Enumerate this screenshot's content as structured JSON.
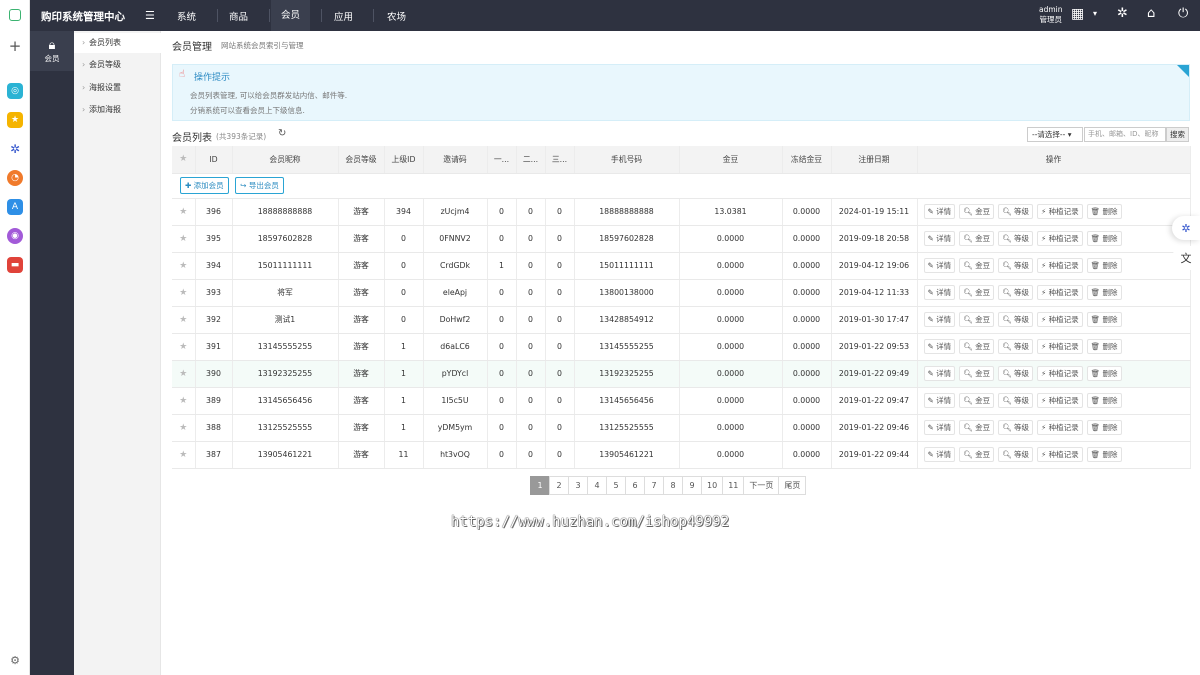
{
  "app": {
    "title": "购印系统管理中心"
  },
  "topnav": [
    "系统",
    "商品",
    "会员",
    "应用",
    "农场"
  ],
  "topnav_active": "会员",
  "user": {
    "name": "admin",
    "role": "管理员"
  },
  "side1": {
    "active_label": "会员"
  },
  "side2": [
    "会员列表",
    "会员等级",
    "海报设置",
    "添加海报"
  ],
  "side2_active": "会员列表",
  "breadcrumb": {
    "title": "会员管理",
    "sub": "网站系统会员索引与管理"
  },
  "tips": {
    "title": "操作提示",
    "lines": [
      "会员列表管理, 可以给会员群发站内信、邮件等.",
      "分销系统可以查看会员上下级信息."
    ]
  },
  "list": {
    "title": "会员列表",
    "count": "(共393条记录)"
  },
  "search": {
    "select": "--请选择--",
    "placeholder": "手机、邮箱、ID、昵称",
    "button": "搜索"
  },
  "table": {
    "headers": [
      "",
      "ID",
      "会员昵称",
      "会员等级",
      "上级ID",
      "邀请码",
      "一...",
      "二...",
      "三...",
      "手机号码",
      "金豆",
      "冻结金豆",
      "注册日期",
      "操作"
    ],
    "toolbar": {
      "add": "添加会员",
      "export": "导出会员"
    },
    "actions": [
      "详情",
      "金豆",
      "等级",
      "种植记录",
      "删除"
    ],
    "rows": [
      {
        "id": "396",
        "nick": "18888888888",
        "level": "游客",
        "pid": "394",
        "code": "zUcjm4",
        "l1": "0",
        "l2": "0",
        "l3": "0",
        "phone": "18888888888",
        "beans": "13.0381",
        "frozen": "0.0000",
        "date": "2024-01-19 15:11"
      },
      {
        "id": "395",
        "nick": "18597602828",
        "level": "游客",
        "pid": "0",
        "code": "0FNNV2",
        "l1": "0",
        "l2": "0",
        "l3": "0",
        "phone": "18597602828",
        "beans": "0.0000",
        "frozen": "0.0000",
        "date": "2019-09-18 20:58"
      },
      {
        "id": "394",
        "nick": "15011111111",
        "level": "游客",
        "pid": "0",
        "code": "CrdGDk",
        "l1": "1",
        "l2": "0",
        "l3": "0",
        "phone": "15011111111",
        "beans": "0.0000",
        "frozen": "0.0000",
        "date": "2019-04-12 19:06"
      },
      {
        "id": "393",
        "nick": "将军",
        "level": "游客",
        "pid": "0",
        "code": "eleApj",
        "l1": "0",
        "l2": "0",
        "l3": "0",
        "phone": "13800138000",
        "beans": "0.0000",
        "frozen": "0.0000",
        "date": "2019-04-12 11:33"
      },
      {
        "id": "392",
        "nick": "测试1",
        "level": "游客",
        "pid": "0",
        "code": "DoHwf2",
        "l1": "0",
        "l2": "0",
        "l3": "0",
        "phone": "13428854912",
        "beans": "0.0000",
        "frozen": "0.0000",
        "date": "2019-01-30 17:47"
      },
      {
        "id": "391",
        "nick": "13145555255",
        "level": "游客",
        "pid": "1",
        "code": "d6aLC6",
        "l1": "0",
        "l2": "0",
        "l3": "0",
        "phone": "13145555255",
        "beans": "0.0000",
        "frozen": "0.0000",
        "date": "2019-01-22 09:53"
      },
      {
        "id": "390",
        "nick": "13192325255",
        "level": "游客",
        "pid": "1",
        "code": "pYDYcl",
        "l1": "0",
        "l2": "0",
        "l3": "0",
        "phone": "13192325255",
        "beans": "0.0000",
        "frozen": "0.0000",
        "date": "2019-01-22 09:49"
      },
      {
        "id": "389",
        "nick": "13145656456",
        "level": "游客",
        "pid": "1",
        "code": "1I5c5U",
        "l1": "0",
        "l2": "0",
        "l3": "0",
        "phone": "13145656456",
        "beans": "0.0000",
        "frozen": "0.0000",
        "date": "2019-01-22 09:47"
      },
      {
        "id": "388",
        "nick": "13125525555",
        "level": "游客",
        "pid": "1",
        "code": "yDM5ym",
        "l1": "0",
        "l2": "0",
        "l3": "0",
        "phone": "13125525555",
        "beans": "0.0000",
        "frozen": "0.0000",
        "date": "2019-01-22 09:46"
      },
      {
        "id": "387",
        "nick": "13905461221",
        "level": "游客",
        "pid": "11",
        "code": "ht3vOQ",
        "l1": "0",
        "l2": "0",
        "l3": "0",
        "phone": "13905461221",
        "beans": "0.0000",
        "frozen": "0.0000",
        "date": "2019-01-22 09:44"
      }
    ]
  },
  "pager": [
    "1",
    "2",
    "3",
    "4",
    "5",
    "6",
    "7",
    "8",
    "9",
    "10",
    "11",
    "下一页",
    "尾页"
  ],
  "pager_current": "1",
  "watermark": "https://www.huzhan.com/ishop49992",
  "colors": {
    "topbar": "#2e3240",
    "accent": "#2aa4d4",
    "tips_bg": "#e9f7fd"
  }
}
